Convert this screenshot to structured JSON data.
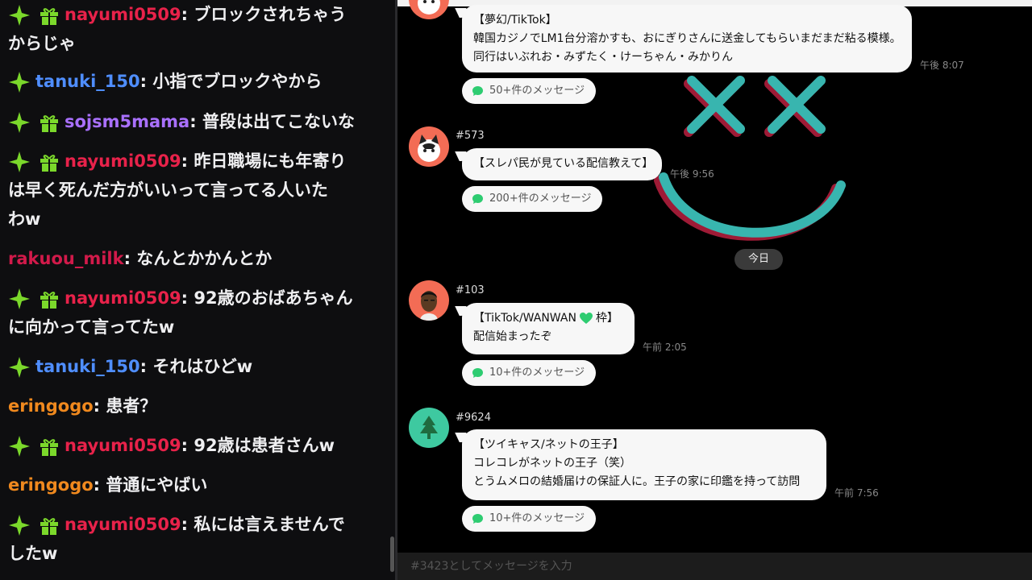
{
  "chat": {
    "colors": {
      "red": "#e8224a",
      "blue": "#4f8eff",
      "purple": "#a970ff",
      "orange": "#f0891e",
      "maroon": "#d11a4a"
    },
    "messages": [
      {
        "user": "nayumi0509",
        "color": "#e8224a",
        "badges": [
          "sparkle",
          "gift"
        ],
        "text": "ブロックされちゃう",
        "text2": "からじゃ"
      },
      {
        "user": "tanuki_150",
        "color": "#4f8eff",
        "badges": [
          "sparkle"
        ],
        "text": "小指でブロックやから"
      },
      {
        "user": "sojsm5mama",
        "color": "#a970ff",
        "badges": [
          "sparkle",
          "gift"
        ],
        "text": "普段は出てこないな"
      },
      {
        "user": "nayumi0509",
        "color": "#e8224a",
        "badges": [
          "sparkle",
          "gift"
        ],
        "text": "昨日職場にも年寄り",
        "text2": "は早く死んだ方がいいって言ってる人いた",
        "text3": "わw"
      },
      {
        "user": "rakuou_milk",
        "color": "#d11a4a",
        "badges": [],
        "text": "なんとかかんとか"
      },
      {
        "user": "nayumi0509",
        "color": "#e8224a",
        "badges": [
          "sparkle",
          "gift"
        ],
        "text": "92歳のおばあちゃん",
        "text2": "に向かって言ってたw"
      },
      {
        "user": "tanuki_150",
        "color": "#4f8eff",
        "badges": [
          "sparkle"
        ],
        "text": "それはひどw"
      },
      {
        "user": "eringogo",
        "color": "#f0891e",
        "badges": [],
        "text": "患者？"
      },
      {
        "user": "nayumi0509",
        "color": "#e8224a",
        "badges": [
          "sparkle",
          "gift"
        ],
        "text": "92歳は患者さんw"
      },
      {
        "user": "eringogo",
        "color": "#f0891e",
        "badges": [],
        "text": "普通にやばい"
      },
      {
        "user": "nayumi0509",
        "color": "#e8224a",
        "badges": [
          "sparkle",
          "gift"
        ],
        "text": "私には言えませんで",
        "text2": "したw"
      }
    ]
  },
  "feed": {
    "posts": [
      {
        "number": "",
        "lines": [
          "【夢幻/TikTok】",
          "韓国カジノでLM1台分溶かすも、おにぎりさんに送金してもらいまだまだ粘る模様。",
          "同行はいぶれお・みずたく・けーちゃん・みかりん"
        ],
        "time": "午後 8:07",
        "thread": "50+件のメッセージ",
        "avatar_icon": "cat-avatar-icon"
      },
      {
        "number": "#573",
        "lines": [
          "【スレパ民が見ている配信教えて】"
        ],
        "time": "午後 9:56",
        "thread": "200+件のメッセージ",
        "avatar_icon": "cat-avatar-icon"
      },
      {
        "number": "#103",
        "lines": [
          "【TikTok/WANWAN",
          "配信始まったぞ"
        ],
        "line1_suffix": "枠】",
        "time": "午前 2:05",
        "thread": "10+件のメッセージ",
        "avatar_icon": "man-avatar-icon"
      },
      {
        "number": "#9624",
        "lines": [
          "【ツイキャス/ネットの王子】",
          "コレコレがネットの王子（笑）",
          "とうムメロの結婚届けの保証人に。王子の家に印鑑を持って訪問"
        ],
        "time": "午前 7:56",
        "thread": "10+件のメッセージ",
        "avatar_icon": "tree-avatar-icon"
      }
    ],
    "date_divider": "今日",
    "composer_placeholder": "#3423としてメッセージを入力"
  }
}
